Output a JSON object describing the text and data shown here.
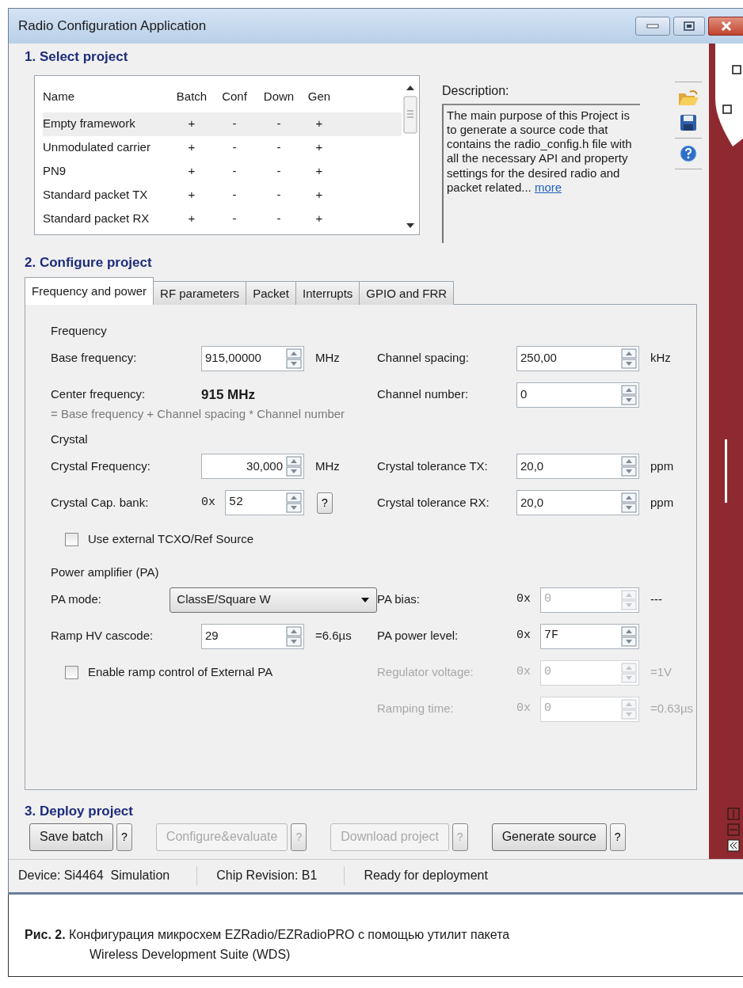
{
  "window": {
    "title": "Radio Configuration Application"
  },
  "select_project": {
    "heading": "1. Select project",
    "table": {
      "columns": [
        "Name",
        "Batch",
        "Conf",
        "Down",
        "Gen"
      ],
      "rows": [
        {
          "cells": [
            "Empty framework",
            "+",
            "-",
            "-",
            "+"
          ],
          "selected": true
        },
        {
          "cells": [
            "Unmodulated carrier",
            "+",
            "-",
            "-",
            "+"
          ],
          "selected": false
        },
        {
          "cells": [
            "PN9",
            "+",
            "-",
            "-",
            "+"
          ],
          "selected": false
        },
        {
          "cells": [
            "Standard packet TX",
            "+",
            "-",
            "-",
            "+"
          ],
          "selected": false
        },
        {
          "cells": [
            "Standard packet RX",
            "+",
            "-",
            "-",
            "+"
          ],
          "selected": false
        }
      ]
    },
    "description": {
      "label": "Description:",
      "text": "The main purpose of this Project is to generate a source code that contains the radio_config.h file with all the necessary API and property settings for the desired radio and packet related...",
      "link": "more"
    }
  },
  "configure_project": {
    "heading": "2. Configure project",
    "tabs": [
      {
        "label": "Frequency and power",
        "selected": true
      },
      {
        "label": "RF parameters",
        "selected": false
      },
      {
        "label": "Packet",
        "selected": false
      },
      {
        "label": "Interrupts",
        "selected": false
      },
      {
        "label": "GPIO and FRR",
        "selected": false
      }
    ],
    "panel": [
      {
        "kind": "heading",
        "text": "Frequency"
      },
      {
        "kind": "row",
        "left": {
          "kind": "spin",
          "label": "Base frequency:",
          "value": "915,00000",
          "unit": "MHz"
        },
        "right": {
          "kind": "spin",
          "label": "Channel spacing:",
          "value": "250,00",
          "unit": "kHz"
        }
      },
      {
        "kind": "row",
        "left": {
          "kind": "readout",
          "label": "Center frequency:",
          "value": "915 MHz"
        },
        "right": {
          "kind": "spin",
          "label": "Channel number:",
          "value": "0"
        }
      },
      {
        "kind": "note",
        "text": "= Base frequency + Channel spacing * Channel number"
      },
      {
        "kind": "heading",
        "text": "Crystal"
      },
      {
        "kind": "row",
        "left": {
          "kind": "spin",
          "label": "Crystal Frequency:",
          "value": "30,000",
          "align_right": true,
          "unit": "MHz"
        },
        "right": {
          "kind": "spin",
          "label": "Crystal tolerance TX:",
          "value": "20,0",
          "unit": "ppm"
        }
      },
      {
        "kind": "row",
        "left": {
          "kind": "spin",
          "label": "Crystal Cap. bank:",
          "prefix": "0x",
          "value": "52",
          "help": "?"
        },
        "right": {
          "kind": "spin",
          "label": "Crystal tolerance RX:",
          "value": "20,0",
          "unit": "ppm"
        }
      },
      {
        "kind": "row",
        "left": {
          "kind": "checkbox",
          "label": "Use external TCXO/Ref Source",
          "checked": false
        }
      },
      {
        "kind": "heading",
        "text": "Power amplifier (PA)"
      },
      {
        "kind": "row",
        "left": {
          "kind": "select",
          "label": "PA mode:",
          "value": "ClassE/Square W"
        },
        "right": {
          "kind": "spin",
          "label": "PA bias:",
          "prefix": "0x",
          "value": "0",
          "readonly": true,
          "unit": "---"
        }
      },
      {
        "kind": "row",
        "left": {
          "kind": "spin",
          "label": "Ramp HV cascode:",
          "value": "29",
          "unit": "=6.6µs"
        },
        "right": {
          "kind": "spin",
          "label": "PA power level:",
          "prefix": "0x",
          "value": "7F"
        }
      },
      {
        "kind": "row",
        "left": {
          "kind": "checkbox",
          "label": "Enable ramp control of External PA",
          "checked": false
        },
        "right": {
          "kind": "spin",
          "label": "Regulator voltage:",
          "prefix": "0x",
          "value": "0",
          "unit": "=1V",
          "disabled": true
        }
      },
      {
        "kind": "row",
        "right": {
          "kind": "spin",
          "label": "Ramping time:",
          "prefix": "0x",
          "value": "0",
          "unit": "=0.63µs",
          "disabled": true
        }
      }
    ]
  },
  "deploy_project": {
    "heading": "3. Deploy project",
    "buttons": [
      {
        "label": "Save batch",
        "help": "?",
        "disabled": false
      },
      {
        "label": "Configure&evaluate",
        "help": "?",
        "disabled": true
      },
      {
        "label": "Download project",
        "help": "?",
        "disabled": true
      },
      {
        "label": "Generate source",
        "help": "?",
        "disabled": false
      }
    ]
  },
  "status_bar": [
    "Device: Si4464  Simulation",
    "Chip Revision: B1",
    "Ready for deployment"
  ],
  "caption": {
    "label": "Рис. 2.",
    "text": "Конфигурация микросхем EZRadio/EZRadioPRO с помощью утилит пакета\nWireless Development Suite (WDS)"
  }
}
